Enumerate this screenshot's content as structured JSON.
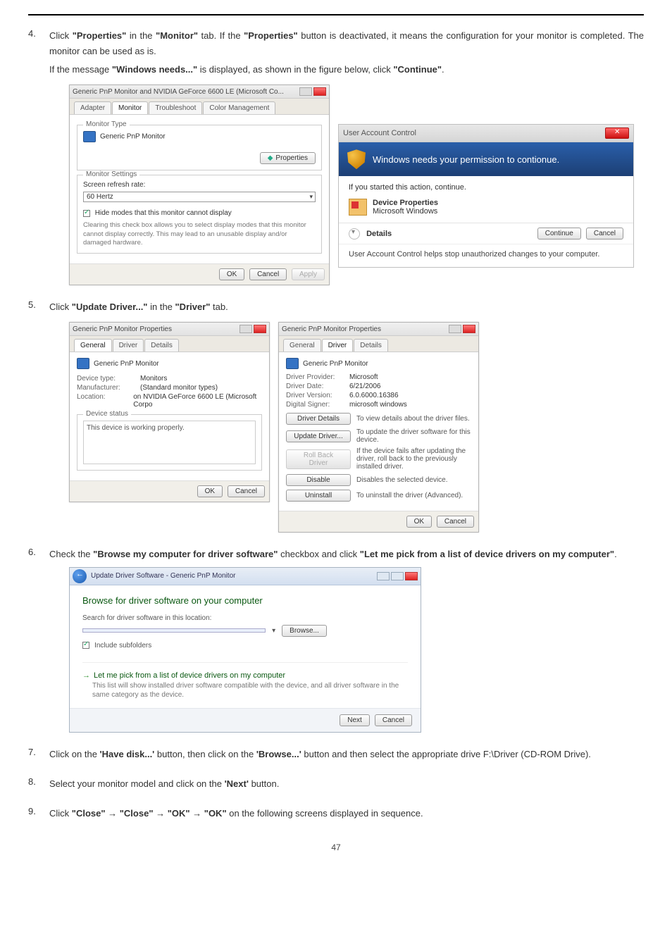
{
  "page_number": "47",
  "steps": {
    "s4": {
      "num": "4.",
      "line1_a": "Click ",
      "line1_b": "\"Properties\"",
      "line1_c": " in the ",
      "line1_d": "\"Monitor\"",
      "line1_e": " tab. If the ",
      "line1_f": "\"Properties\"",
      "line1_g": " button is deactivated, it means the configuration for your monitor is completed. The monitor can be used as is.",
      "line2_a": "If the message ",
      "line2_b": "\"Windows needs...\"",
      "line2_c": " is displayed, as shown in the figure below, click ",
      "line2_d": "\"Continue\"",
      "line2_e": "."
    },
    "s5": {
      "num": "5.",
      "text_a": "Click ",
      "text_b": "\"Update Driver...\"",
      "text_c": " in the ",
      "text_d": "\"Driver\"",
      "text_e": " tab."
    },
    "s6": {
      "num": "6.",
      "text_a": "Check the ",
      "text_b": "\"Browse my computer for driver software\"",
      "text_c": " checkbox and click ",
      "text_d": "\"Let me pick from a list of device drivers on my computer\"",
      "text_e": "."
    },
    "s7": {
      "num": "7.",
      "text_a": "Click on the ",
      "text_b": "'Have disk...'",
      "text_c": " button, then click on the ",
      "text_d": "'Browse...'",
      "text_e": " button and then select the appropriate drive F:\\Driver (CD-ROM Drive)."
    },
    "s8": {
      "num": "8.",
      "text_a": "Select your monitor model and click on the ",
      "text_b": "'Next'",
      "text_c": " button."
    },
    "s9": {
      "num": "9.",
      "text_a": "Click ",
      "text_b": "\"Close\"",
      "arrow": " → ",
      "text_c": "\"Close\"",
      "text_d": "\"OK\"",
      "text_e": "\"OK\"",
      "text_f": " on the following screens displayed in sequence."
    }
  },
  "win_monitor": {
    "title": "Generic PnP Monitor and NVIDIA GeForce 6600 LE (Microsoft Co...",
    "tabs": [
      "Adapter",
      "Monitor",
      "Troubleshoot",
      "Color Management"
    ],
    "group_type": "Monitor Type",
    "monitor_name": "Generic PnP Monitor",
    "properties_btn": "Properties",
    "group_settings": "Monitor Settings",
    "refresh_label": "Screen refresh rate:",
    "refresh_value": "60 Hertz",
    "hide_label": "Hide modes that this monitor cannot display",
    "clearing_text": "Clearing this check box allows you to select display modes that this monitor cannot display correctly. This may lead to an unusable display and/or damaged hardware.",
    "ok": "OK",
    "cancel": "Cancel",
    "apply": "Apply"
  },
  "uac": {
    "title": "User Account Control",
    "banner": "Windows needs your permission to contionue.",
    "started": "If you started this action, continue.",
    "devprops": "Device Properties",
    "mswin": "Microsoft Windows",
    "details": "Details",
    "continue": "Continue",
    "cancel": "Cancel",
    "footer": "User Account Control helps stop unauthorized changes to your computer."
  },
  "prop_general": {
    "title": "Generic PnP Monitor Properties",
    "tabs": [
      "General",
      "Driver",
      "Details"
    ],
    "heading": "Generic PnP Monitor",
    "kv": {
      "devtype_k": "Device type:",
      "devtype_v": "Monitors",
      "manuf_k": "Manufacturer:",
      "manuf_v": "(Standard monitor types)",
      "loc_k": "Location:",
      "loc_v": "on NVIDIA GeForce 6600 LE (Microsoft Corpo"
    },
    "status_legend": "Device status",
    "status_text": "This device is working properly.",
    "ok": "OK",
    "cancel": "Cancel"
  },
  "prop_driver": {
    "title": "Generic PnP Monitor Properties",
    "tabs": [
      "General",
      "Driver",
      "Details"
    ],
    "heading": "Generic PnP Monitor",
    "kv": {
      "prov_k": "Driver Provider:",
      "prov_v": "Microsoft",
      "date_k": "Driver Date:",
      "date_v": "6/21/2006",
      "ver_k": "Driver Version:",
      "ver_v": "6.0.6000.16386",
      "sign_k": "Digital Signer:",
      "sign_v": "microsoft windows"
    },
    "btns": {
      "details": "Driver Details",
      "details_d": "To view details about the driver files.",
      "update": "Update Driver...",
      "update_d": "To update the driver software for this device.",
      "rollback": "Roll Back Driver",
      "rollback_d": "If the device fails after updating the driver, roll back to the previously installed driver.",
      "disable": "Disable",
      "disable_d": "Disables the selected device.",
      "uninstall": "Uninstall",
      "uninstall_d": "To uninstall the driver (Advanced)."
    },
    "ok": "OK",
    "cancel": "Cancel"
  },
  "wizard": {
    "title": "Update Driver Software - Generic PnP Monitor",
    "heading": "Browse for driver software on your computer",
    "search_label": "Search for driver software in this location:",
    "path": "",
    "browse": "Browse...",
    "include": "Include subfolders",
    "opt_title": "Let me pick from a list of device drivers on my computer",
    "opt_sub": "This list will show installed driver software compatible with the device, and all driver software in the same category as the device.",
    "next": "Next",
    "cancel": "Cancel"
  }
}
